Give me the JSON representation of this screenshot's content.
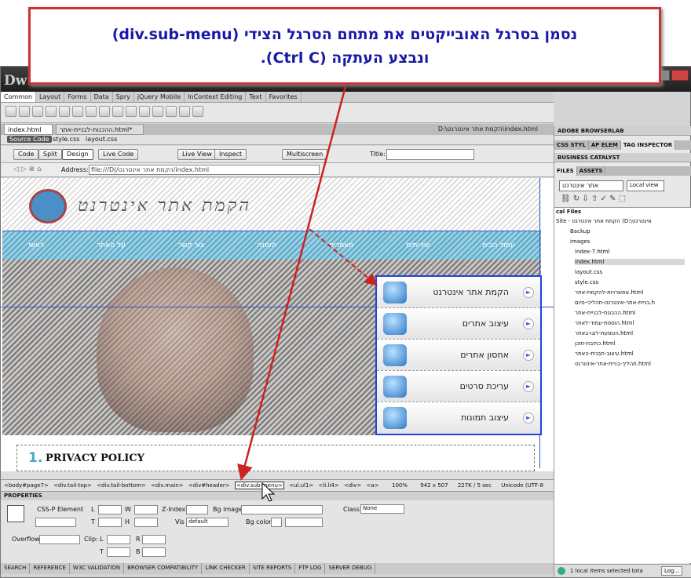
{
  "callout": {
    "line1": "נסמן בסרגל האובייקטים את מתחם הסרגל הצידי (div.sub-menu)",
    "line2": "ונבצע העתקה (Ctrl C)."
  },
  "app": {
    "logo": "Dw"
  },
  "insert_tabs": [
    "Common",
    "Layout",
    "Forms",
    "Data",
    "Spry",
    "jQuery Mobile",
    "InContext Editing",
    "Text",
    "Favorites"
  ],
  "doc_tabs": {
    "tab1": "index.html",
    "tab2": "ההכנות-לבניית-אתר.html*",
    "path": "D:\\הקמת אתר אינטרנט\\index.html"
  },
  "source_bar": {
    "source_code": "Source Code",
    "file1": "style.css",
    "file2": "layout.css"
  },
  "doc_toolbar": {
    "code": "Code",
    "split": "Split",
    "design": "Design",
    "live_code": "Live Code",
    "live_view": "Live View",
    "inspect": "Inspect",
    "multiscreen": "Multiscreen",
    "title_label": "Title:"
  },
  "address": {
    "label": "Address:",
    "value": "file:///D|/הקמת אתר אינטרנט/index.html"
  },
  "design": {
    "site_title": "הקמת אתר אינטרנט",
    "nav_items": [
      "ראשי",
      "על האתר",
      "צור קשר",
      "הזמנה",
      "מאמרים",
      "שירותים",
      "עמוד הבית"
    ],
    "submenu": [
      "הקמת אתר אינטרנט",
      "עיצוב אתרים",
      "אחסון אתרים",
      "עריכת סרטים",
      "עיצוב תמונות"
    ],
    "privacy_num": "1.",
    "privacy_text": "PRIVACY POLICY"
  },
  "tag_selector": {
    "tags": [
      "<body#page7>",
      "<div.tail-top>",
      "<div.tail-bottom>",
      "<div.main>",
      "<div#header>",
      "<div.sub-menu>",
      "<ul.ul1>",
      "<li.li4>",
      "<div>",
      "<a>"
    ],
    "zoom": "100%",
    "size": "942 x 507",
    "weight": "227K / 5 sec",
    "encoding": "Unicode (UTF-8"
  },
  "properties": {
    "header": "PROPERTIES",
    "element": "CSS-P Element",
    "labels": {
      "L": "L",
      "W": "W",
      "T": "T",
      "H": "H",
      "zindex": "Z-Index",
      "vis": "Vis",
      "bgimage": "Bg image",
      "bgcolor": "Bg color",
      "class": "Class",
      "overflow": "Overflow",
      "clip": "Clip:",
      "clipL": "L",
      "clipR": "R",
      "clipT": "T",
      "clipB": "B"
    },
    "vis_value": "default",
    "class_value": "None"
  },
  "bottom_tabs": [
    "SEARCH",
    "REFERENCE",
    "W3C VALIDATION",
    "BROWSER COMPATIBILITY",
    "LINK CHECKER",
    "SITE REPORTS",
    "FTP LOG",
    "SERVER DEBUG"
  ],
  "right_panel": {
    "browserlab": "ADOBE BROWSERLAB",
    "css_tabs": [
      "CSS STYL",
      "AP ELEM",
      "TAG INSPECTOR"
    ],
    "business": "BUSINESS CATALYST",
    "files_tabs": [
      "FILES",
      "ASSETS"
    ],
    "site_select": "אתר אינטרנט",
    "view_select": "Local view",
    "local_files": "cal Files",
    "files": [
      "Site - הקמת אתר אינטרנט (D:\\אינטרנט",
      "Backup",
      "images",
      "index-7.html",
      "index.html",
      "layout.css",
      "style.css",
      "אפשרויות-להקמת-אתר.html",
      "בניית-אתר-אינטרנט-תהליכי-סיום.h",
      "ההכנות-לבניית-אתר.html",
      "הוספת-עמוד-לאתר.html",
      "הטמעת-לוגו-באתר.html",
      "כתיבת-תוכן.html",
      "עיצוב-תבנית-האתר.html",
      "תהליך-בניית-אתר-אינטרנט.html"
    ],
    "status": "1 local items selected tota",
    "log": "Log..."
  },
  "colors": {
    "callout_border": "#cc3333",
    "callout_text": "#1a1aa8",
    "selection": "#2244dd"
  }
}
